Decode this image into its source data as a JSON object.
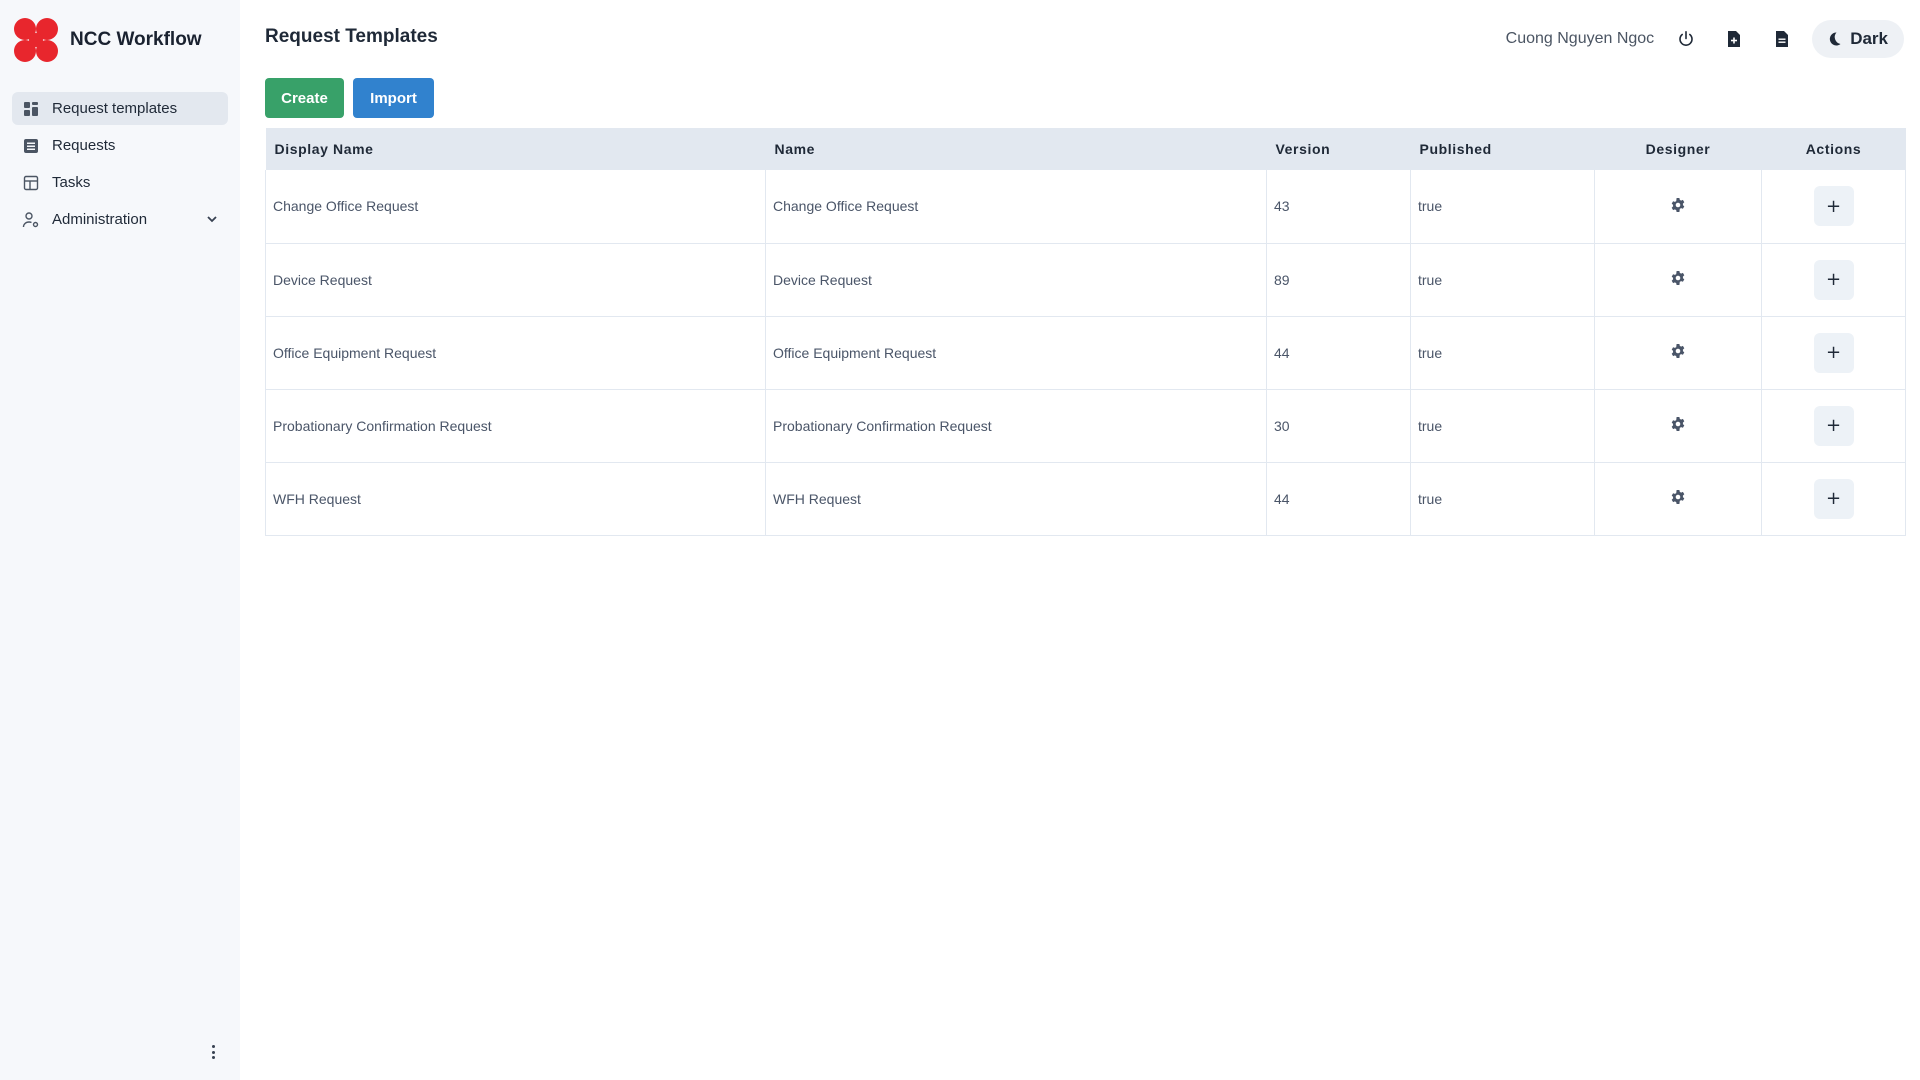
{
  "app": {
    "title": "NCC Workflow"
  },
  "sidebar": {
    "items": [
      {
        "label": "Request templates",
        "icon": "grid-icon",
        "active": true
      },
      {
        "label": "Requests",
        "icon": "list-icon",
        "active": false
      },
      {
        "label": "Tasks",
        "icon": "table-icon",
        "active": false
      },
      {
        "label": "Administration",
        "icon": "user-settings-icon",
        "active": false,
        "expandable": true
      }
    ]
  },
  "header": {
    "title": "Request Templates",
    "user_name": "Cuong Nguyen Ngoc",
    "theme_label": "Dark"
  },
  "toolbar": {
    "create_label": "Create",
    "import_label": "Import"
  },
  "table": {
    "columns": [
      "Display Name",
      "Name",
      "Version",
      "Published",
      "Designer",
      "Actions"
    ],
    "rows": [
      {
        "display_name": "Change Office Request",
        "name": "Change Office Request",
        "version": "43",
        "published": "true",
        "action": "+"
      },
      {
        "display_name": "Device Request",
        "name": "Device Request",
        "version": "89",
        "published": "true",
        "action": "+"
      },
      {
        "display_name": "Office Equipment Request",
        "name": "Office Equipment Request",
        "version": "44",
        "published": "true",
        "action": "+"
      },
      {
        "display_name": "Probationary Confirmation Request",
        "name": "Probationary Confirmation Request",
        "version": "30",
        "published": "true",
        "action": "+"
      },
      {
        "display_name": "WFH Request",
        "name": "WFH Request",
        "version": "44",
        "published": "true",
        "action": "+"
      }
    ]
  },
  "colors": {
    "brand": "#e8262d",
    "create": "#38a169",
    "import": "#3182ce",
    "sidebar_bg": "#f6f8fb",
    "table_header": "#e2e8f0"
  }
}
